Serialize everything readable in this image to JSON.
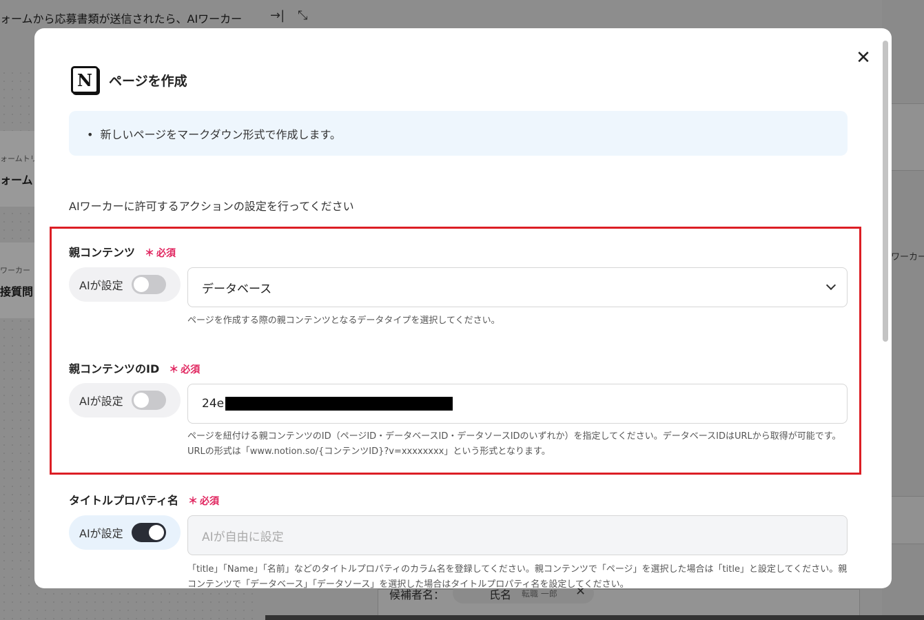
{
  "background": {
    "title": "ォームから応募書類が送信されたら、AIワーカー",
    "card1_sub": "ォームトリ",
    "card1_main": "ォーム",
    "card2_sub": "ワーカー",
    "card2_main": "接質問",
    "right_text": "ワーカー",
    "bottom_label": "候補者名：",
    "chip_name": "氏名",
    "chip_sub": "転職 一郎"
  },
  "modal": {
    "title": "ページを作成",
    "info_items": [
      "新しいページをマークダウン形式で作成します。"
    ],
    "instruction": "AIワーカーに許可するアクションの設定を行ってください",
    "required_label": "必須",
    "required_star": "＊",
    "fields": [
      {
        "label": "親コンテンツ",
        "ai_label": "AIが設定",
        "ai_enabled": false,
        "value": "データベース",
        "help": "ページを作成する際の親コンテンツとなるデータタイプを選択してください。"
      },
      {
        "label": "親コンテンツのID",
        "ai_label": "AIが設定",
        "ai_enabled": false,
        "value": "24e",
        "help": "ページを紐付ける親コンテンツのID（ページID・データベースID・データソースIDのいずれか）を指定してください。データベースIDはURLから取得が可能です。URLの形式は「www.notion.so/{コンテンツID}?v=xxxxxxxx」という形式となります。"
      },
      {
        "label": "タイトルプロパティ名",
        "ai_label": "AIが設定",
        "ai_enabled": true,
        "placeholder": "AIが自由に設定",
        "help": "「title」「Name」「名前」などのタイトルプロパティのカラム名を登録してください。親コンテンツで「ページ」を選択した場合は「title」と設定してください。親コンテンツで「データベース」「データソース」を選択した場合はタイトルプロパティ名を設定してください。"
      }
    ]
  },
  "colors": {
    "highlight": "#dc1e25",
    "required": "#e0245e",
    "info_bg": "#eef6fd"
  }
}
